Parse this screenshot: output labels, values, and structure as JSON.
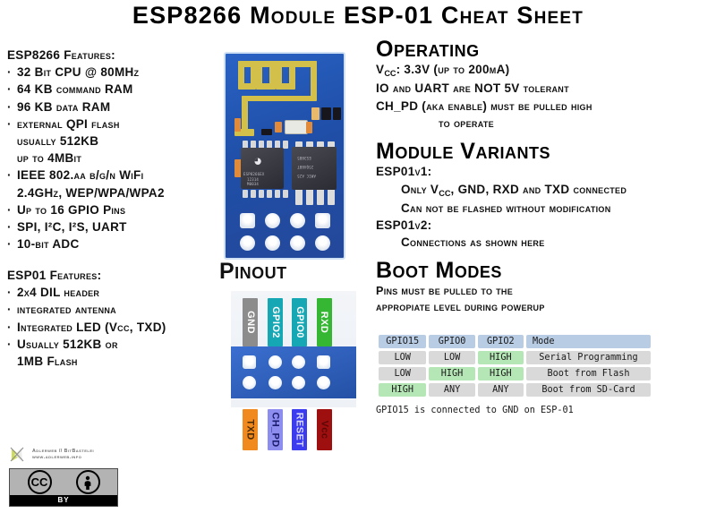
{
  "title": "ESP8266 Module ESP-01 Cheat Sheet",
  "left": {
    "esp8266": {
      "heading": "ESP8266 Features:",
      "items": [
        {
          "text": "32 Bit CPU @ 80MHz",
          "bullet": true
        },
        {
          "text": "64 KB command RAM",
          "bullet": true
        },
        {
          "text": "96 KB data RAM",
          "bullet": true
        },
        {
          "text": "external QPI flash",
          "bullet": true
        },
        {
          "text": "usually 512KB",
          "bullet": false
        },
        {
          "text": "up to 4MBit",
          "bullet": false
        },
        {
          "text": "IEEE 802.aa b/g/n WiFi",
          "bullet": true
        },
        {
          "text": "2.4GHz, WEP/WPA/WPA2",
          "bullet": false
        },
        {
          "text": "Up to 16 GPIO Pins",
          "bullet": true
        },
        {
          "text": "SPI, I²C, I²S, UART",
          "bullet": true
        },
        {
          "text": "10-bit ADC",
          "bullet": true
        }
      ]
    },
    "esp01": {
      "heading": "ESP01 Features:",
      "items": [
        {
          "text": "2x4 DIL header",
          "bullet": true
        },
        {
          "text": "integrated antenna",
          "bullet": true
        },
        {
          "text": "Integrated LED (Vcc, TXD)",
          "bullet": true
        },
        {
          "text": "Usually 512KB or",
          "bullet": true
        },
        {
          "text": "1MB Flash",
          "bullet": false
        }
      ]
    }
  },
  "right": {
    "operating": {
      "heading": "Operating",
      "lines": [
        "Vcc: 3.3V (up to 200mA)",
        "IO and UART are NOT 5V tolerant",
        "CH_PD (aka enable) must be pulled high",
        "to operate"
      ]
    },
    "variants": {
      "heading": "Module Variants",
      "v1_label": "ESP01v1:",
      "v1_lines": [
        "Only Vcc, GND, RXD and TXD connected",
        "Can not be flashed without modification"
      ],
      "v2_label": "ESP01v2:",
      "v2_lines": [
        "Connections as shown here"
      ]
    },
    "boot": {
      "heading": "Boot Modes",
      "note_lines": [
        "Pins must be pulled to the",
        "appropiate level during powerup"
      ],
      "table": {
        "headers": [
          "GPIO15",
          "GPIO0",
          "GPIO2",
          "Mode"
        ],
        "rows": [
          {
            "cells": [
              "LOW",
              "LOW",
              "HIGH",
              "Serial Programming"
            ],
            "states": [
              "low",
              "low",
              "high",
              "mode"
            ]
          },
          {
            "cells": [
              "LOW",
              "HIGH",
              "HIGH",
              "Boot from Flash"
            ],
            "states": [
              "low",
              "high",
              "high",
              "mode"
            ]
          },
          {
            "cells": [
              "HIGH",
              "ANY",
              "ANY",
              "Boot from SD-Card"
            ],
            "states": [
              "high",
              "low",
              "low",
              "mode"
            ]
          }
        ]
      },
      "footnote": "GPIO15 is connected to GND on ESP-01"
    }
  },
  "pinout": {
    "heading": "Pinout",
    "top_pins": [
      {
        "label": "GND",
        "color": "#8c8c8c",
        "text_color": "#ffffff"
      },
      {
        "label": "GPIO2",
        "color": "#16a7b4",
        "text_color": "#ffffff"
      },
      {
        "label": "GPIO0",
        "color": "#16a7b4",
        "text_color": "#ffffff"
      },
      {
        "label": "RXD",
        "color": "#35b734",
        "text_color": "#ffffff"
      }
    ],
    "bottom_pins": [
      {
        "label": "TXD",
        "color": "#f08a1e",
        "text_color": "#4a2a00"
      },
      {
        "label": "CH_PD",
        "color": "#8d8df0",
        "text_color": "#1c1c6e"
      },
      {
        "label": "RESET",
        "color": "#3b3bef",
        "text_color": "#d8d8ff"
      },
      {
        "label": "Vcc",
        "color": "#9e1010",
        "text_color": "#5e0606"
      }
    ]
  },
  "footer": {
    "brand_line1": "Adlerweb // BitBastelei",
    "brand_line2": "www.adlerweb.info",
    "cc_mark": "CC",
    "cc_person": "i",
    "cc_by": "BY"
  },
  "colors": {
    "header_blue": "#b8cce4",
    "neutral_gray": "#d9d9d9",
    "high_green": "#b5e6b5",
    "pcb_blue": "#2a62c4",
    "antenna_gold": "#d3c04a"
  }
}
